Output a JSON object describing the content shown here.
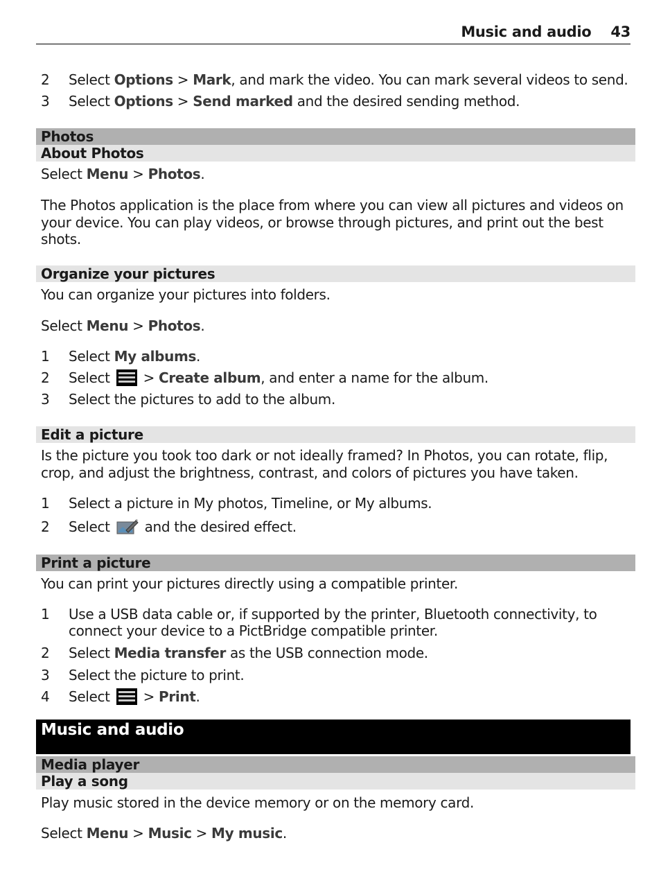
{
  "header": {
    "chapter": "Music and audio",
    "page_number": "43"
  },
  "top_steps": [
    {
      "n": "2",
      "pre": "Select ",
      "k1": "Options",
      "sep": " > ",
      "k2": "Mark",
      "post": ", and mark the video. You can mark several videos to send."
    },
    {
      "n": "3",
      "pre": "Select ",
      "k1": "Options",
      "sep": " > ",
      "k2": "Send marked",
      "post": " and the desired sending method."
    }
  ],
  "photos": {
    "title": "Photos",
    "about": {
      "title": "About Photos",
      "select": {
        "pre": "Select ",
        "k1": "Menu",
        "sep": " > ",
        "k2": "Photos",
        "post": "."
      },
      "desc": "The Photos application is the place from where you can view all pictures and videos on your device. You can play videos, or browse through pictures, and print out the best shots."
    },
    "organize": {
      "title": "Organize your pictures",
      "intro": "You can organize your pictures into folders.",
      "select": {
        "pre": "Select ",
        "k1": "Menu",
        "sep": " > ",
        "k2": "Photos",
        "post": "."
      },
      "steps": [
        {
          "n": "1",
          "pre": "Select ",
          "k": "My albums",
          "post": "."
        },
        {
          "n": "2",
          "pre": "Select ",
          "icon": "options-menu-icon",
          "sep": " > ",
          "k": "Create album",
          "post": ", and enter a name for the album."
        },
        {
          "n": "3",
          "text": "Select the pictures to add to the album."
        }
      ]
    },
    "edit": {
      "title": "Edit a picture",
      "intro": "Is the picture you took too dark or not ideally framed? In Photos, you can rotate, flip, crop, and adjust the brightness, contrast, and colors of pictures you have taken.",
      "steps": [
        {
          "n": "1",
          "text": "Select a picture in My photos, Timeline, or My albums."
        },
        {
          "n": "2",
          "pre": "Select ",
          "icon": "edit-picture-icon",
          "post": " and the desired effect."
        }
      ]
    },
    "print": {
      "title": "Print a picture",
      "intro": "You can print your pictures directly using a compatible printer.",
      "steps": [
        {
          "n": "1",
          "text": "Use a USB data cable or, if supported by the printer, Bluetooth connectivity, to connect your device to a PictBridge compatible printer."
        },
        {
          "n": "2",
          "pre": "Select ",
          "k": "Media transfer",
          "post": " as the USB connection mode."
        },
        {
          "n": "3",
          "text": "Select the picture to print."
        },
        {
          "n": "4",
          "pre": "Select ",
          "icon": "options-menu-icon",
          "sep": " > ",
          "k": "Print",
          "post": "."
        }
      ]
    }
  },
  "music": {
    "chapter_title": "Music and audio",
    "section": "Media player",
    "subsection": "Play a song",
    "intro": "Play music stored in the device memory or on the memory card.",
    "select": {
      "pre": "Select ",
      "k1": "Menu",
      "sep1": " > ",
      "k2": "Music",
      "sep2": " > ",
      "k3": "My music",
      "post": "."
    }
  }
}
